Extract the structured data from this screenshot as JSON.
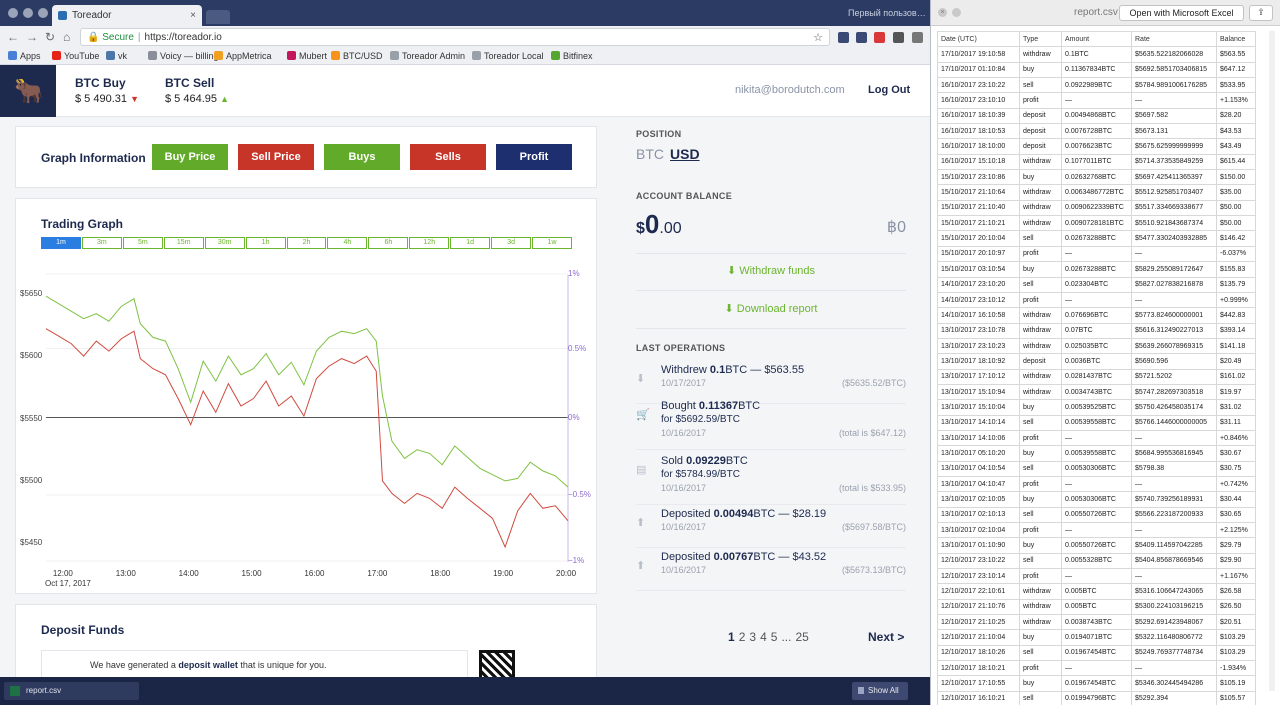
{
  "browser": {
    "tab_title": "Toreador",
    "user_label": "Первый пользов…",
    "secure_label": "Secure",
    "url": "https://toreador.io",
    "bookmarks": [
      {
        "label": "Apps",
        "color": "#4a7fd6"
      },
      {
        "label": "YouTube",
        "color": "#e62117"
      },
      {
        "label": "vk",
        "color": "#4a76a8"
      },
      {
        "label": "Voicy — billing",
        "color": "#8a8f99"
      },
      {
        "label": "AppMetrica",
        "color": "#f0a020"
      },
      {
        "label": "Mubert",
        "color": "#c2185b"
      },
      {
        "label": "BTC/USD",
        "color": "#f7931a"
      },
      {
        "label": "Toreador Admin",
        "color": "#9aa0a8"
      },
      {
        "label": "Toreador Local",
        "color": "#9aa0a8"
      },
      {
        "label": "Bitfinex",
        "color": "#55a630"
      }
    ]
  },
  "header": {
    "btc_buy_label": "BTC Buy",
    "btc_buy_value": "$ 5 490.31",
    "btc_sell_label": "BTC Sell",
    "btc_sell_value": "$ 5 464.95",
    "email": "nikita@borodutch.com",
    "logout": "Log Out"
  },
  "graph_info": {
    "title": "Graph Information",
    "buttons": [
      {
        "label": "Buy Price",
        "color": "#62ab2a"
      },
      {
        "label": "Sell Price",
        "color": "#c63528"
      },
      {
        "label": "Buys",
        "color": "#62ab2a"
      },
      {
        "label": "Sells",
        "color": "#c63528"
      },
      {
        "label": "Profit",
        "color": "#1d2f6f"
      }
    ]
  },
  "trading_graph": {
    "title": "Trading Graph",
    "timeframes": [
      "1m",
      "3m",
      "5m",
      "15m",
      "30m",
      "1h",
      "2h",
      "4h",
      "6h",
      "12h",
      "1d",
      "3d",
      "1w"
    ],
    "active_timeframe": "1m"
  },
  "chart_data": {
    "type": "line",
    "y_left_ticks": [
      "$5650",
      "$5600",
      "$5550",
      "$5500",
      "$5450"
    ],
    "y_right_ticks": [
      "1%",
      "0.5%",
      "0%",
      "−0.5%",
      "−1%"
    ],
    "x_ticks": [
      "12:00",
      "13:00",
      "14:00",
      "15:00",
      "16:00",
      "17:00",
      "18:00",
      "19:00",
      "20:00"
    ],
    "x_date_label": "Oct 17, 2017",
    "ylim": [
      5435,
      5665
    ],
    "xlim": [
      11.7,
      20.0
    ],
    "baseline": 5546,
    "series": [
      {
        "color": "#7ec244",
        "x": [
          11.7,
          11.9,
          12.1,
          12.3,
          12.5,
          12.7,
          12.9,
          13.1,
          13.2,
          13.4,
          13.6,
          13.8,
          14.0,
          14.2,
          14.4,
          14.6,
          14.8,
          15.0,
          15.2,
          15.4,
          15.6,
          15.8,
          16.0,
          16.2,
          16.4,
          16.6,
          16.8,
          16.95,
          17.05,
          17.2,
          17.4,
          17.6,
          17.8,
          18.0,
          18.2,
          18.4,
          18.6,
          18.8,
          19.0,
          19.2,
          19.4,
          19.6,
          19.8,
          20.0
        ],
        "values": [
          5648,
          5642,
          5636,
          5630,
          5634,
          5628,
          5640,
          5646,
          5626,
          5615,
          5612,
          5590,
          5563,
          5596,
          5580,
          5600,
          5585,
          5590,
          5602,
          5585,
          5595,
          5577,
          5604,
          5615,
          5620,
          5618,
          5622,
          5612,
          5568,
          5532,
          5518,
          5525,
          5522,
          5513,
          5528,
          5519,
          5510,
          5505,
          5500,
          5502,
          5515,
          5508,
          5504,
          5495
        ]
      },
      {
        "color": "#cf4a3e",
        "x": [
          11.7,
          11.9,
          12.1,
          12.3,
          12.5,
          12.7,
          12.9,
          13.1,
          13.2,
          13.4,
          13.6,
          13.8,
          14.0,
          14.2,
          14.4,
          14.6,
          14.8,
          15.0,
          15.2,
          15.4,
          15.6,
          15.8,
          16.0,
          16.2,
          16.4,
          16.6,
          16.8,
          16.95,
          17.05,
          17.2,
          17.4,
          17.6,
          17.8,
          18.0,
          18.2,
          18.4,
          18.6,
          18.8,
          19.0,
          19.2,
          19.4,
          19.6,
          19.8,
          20.0
        ],
        "values": [
          5622,
          5616,
          5610,
          5600,
          5612,
          5604,
          5614,
          5620,
          5598,
          5590,
          5585,
          5566,
          5545,
          5572,
          5555,
          5578,
          5560,
          5566,
          5580,
          5560,
          5568,
          5552,
          5582,
          5592,
          5598,
          5594,
          5600,
          5588,
          5500,
          5490,
          5482,
          5490,
          5486,
          5478,
          5495,
          5486,
          5478,
          5470,
          5447,
          5476,
          5490,
          5478,
          5480,
          5468
        ]
      }
    ]
  },
  "deposit": {
    "title": "Deposit Funds",
    "text_pre": "We have generated a ",
    "text_bold": "deposit wallet",
    "text_post": " that is unique for you."
  },
  "right": {
    "position_label": "POSITION",
    "pos_btc": "BTC",
    "pos_usd": "USD",
    "balance_label": "ACCOUNT BALANCE",
    "balance_sym": "$",
    "balance_int": "0",
    "balance_dec": ".00",
    "balance_btc": "฿0",
    "withdraw": "Withdraw funds",
    "download": "Download report",
    "last_ops_label": "LAST OPERATIONS"
  },
  "operations": [
    {
      "icon": "download-icon",
      "glyph": "⬇",
      "l1_pre": "Withdrew ",
      "l1_bold": "0.1",
      "l1_post": "BTC — $563.55",
      "l2": "",
      "date": "10/17/2017",
      "right": "($5635.52/BTC)"
    },
    {
      "icon": "cart-icon",
      "glyph": "🛒",
      "l1_pre": "Bought ",
      "l1_bold": "0.11367",
      "l1_post": "BTC",
      "l2": "for $5692.59/BTC",
      "date": "10/16/2017",
      "right": "(total is $647.12)"
    },
    {
      "icon": "store-icon",
      "glyph": "▤",
      "l1_pre": "Sold ",
      "l1_bold": "0.09229",
      "l1_post": "BTC",
      "l2": "for $5784.99/BTC",
      "date": "10/16/2017",
      "right": "(total is $533.95)"
    },
    {
      "icon": "upload-icon",
      "glyph": "⬆",
      "l1_pre": "Deposited ",
      "l1_bold": "0.00494",
      "l1_post": "BTC — $28.19",
      "l2": "",
      "date": "10/16/2017",
      "right": "($5697.58/BTC)"
    },
    {
      "icon": "upload-icon",
      "glyph": "⬆",
      "l1_pre": "Deposited ",
      "l1_bold": "0.00767",
      "l1_post": "BTC — $43.52",
      "l2": "",
      "date": "10/16/2017",
      "right": "($5673.13/BTC)"
    }
  ],
  "pagination": {
    "pages": [
      "1",
      "2",
      "3",
      "4",
      "5",
      "...",
      "25"
    ],
    "next": "Next >"
  },
  "downloads": {
    "file": "report.csv",
    "show_all": "Show All"
  },
  "csv": {
    "title": "report.csv",
    "open_excel": "Open with Microsoft Excel",
    "columns": [
      "Date (UTC)",
      "Type",
      "Amount",
      "Rate",
      "Balance"
    ],
    "rows": [
      [
        "17/10/2017 19:10:58",
        "withdraw",
        "0.1BTC",
        "$5635.522182066028",
        "$563.55"
      ],
      [
        "17/10/2017 01:10:84",
        "buy",
        "0.11367834BTC",
        "$5692.5851703406815",
        "$647.12"
      ],
      [
        "16/10/2017 23:10:22",
        "sell",
        "0.0922989BTC",
        "$5784.9891006176285",
        "$533.95"
      ],
      [
        "16/10/2017 23:10:10",
        "profit",
        "—",
        "—",
        "+1.153%"
      ],
      [
        "16/10/2017 18:10:39",
        "deposit",
        "0.00494868BTC",
        "$5697.582",
        "$28.20"
      ],
      [
        "16/10/2017 18:10:53",
        "deposit",
        "0.0076728BTC",
        "$5673.131",
        "$43.53"
      ],
      [
        "16/10/2017 18:10:00",
        "deposit",
        "0.0076623BTC",
        "$5675.625999999999",
        "$43.49"
      ],
      [
        "16/10/2017 15:10:18",
        "withdraw",
        "0.1077011BTC",
        "$5714.373535849259",
        "$615.44"
      ],
      [
        "15/10/2017 23:10:86",
        "buy",
        "0.02632768BTC",
        "$5697.425411365397",
        "$150.00"
      ],
      [
        "15/10/2017 21:10:64",
        "withdraw",
        "0.0063486772BTC",
        "$5512.925851703407",
        "$35.00"
      ],
      [
        "15/10/2017 21:10:40",
        "withdraw",
        "0.0090622339BTC",
        "$5517.334669338677",
        "$50.00"
      ],
      [
        "15/10/2017 21:10:21",
        "withdraw",
        "0.0090728181BTC",
        "$5510.921843687374",
        "$50.00"
      ],
      [
        "15/10/2017 20:10:04",
        "sell",
        "0.02673288BTC",
        "$5477.3302403932885",
        "$146.42"
      ],
      [
        "15/10/2017 20:10:97",
        "profit",
        "—",
        "—",
        "-6.037%"
      ],
      [
        "15/10/2017 03:10:54",
        "buy",
        "0.02673288BTC",
        "$5829.255089172647",
        "$155.83"
      ],
      [
        "14/10/2017 23:10:20",
        "sell",
        "0.023304BTC",
        "$5827.027838216878",
        "$135.79"
      ],
      [
        "14/10/2017 23:10:12",
        "profit",
        "—",
        "—",
        "+0.999%"
      ],
      [
        "14/10/2017 16:10:58",
        "withdraw",
        "0.076696BTC",
        "$5773.824600000001",
        "$442.83"
      ],
      [
        "13/10/2017 23:10:78",
        "withdraw",
        "0.07BTC",
        "$5616.312490227013",
        "$393.14"
      ],
      [
        "13/10/2017 23:10:23",
        "withdraw",
        "0.025035BTC",
        "$5639.266078969315",
        "$141.18"
      ],
      [
        "13/10/2017 18:10:92",
        "deposit",
        "0.0036BTC",
        "$5690.596",
        "$20.49"
      ],
      [
        "13/10/2017 17:10:12",
        "withdraw",
        "0.0281437BTC",
        "$5721.5202",
        "$161.02"
      ],
      [
        "13/10/2017 15:10:94",
        "withdraw",
        "0.0034743BTC",
        "$5747.282697303518",
        "$19.97"
      ],
      [
        "13/10/2017 15:10:04",
        "buy",
        "0.00539525BTC",
        "$5750.426458035174",
        "$31.02"
      ],
      [
        "13/10/2017 14:10:14",
        "sell",
        "0.00539558BTC",
        "$5766.1446000000005",
        "$31.11"
      ],
      [
        "13/10/2017 14:10:06",
        "profit",
        "—",
        "—",
        "+0.846%"
      ],
      [
        "13/10/2017 05:10:20",
        "buy",
        "0.00539558BTC",
        "$5684.995536816945",
        "$30.67"
      ],
      [
        "13/10/2017 04:10:54",
        "sell",
        "0.00530306BTC",
        "$5798.38",
        "$30.75"
      ],
      [
        "13/10/2017 04:10:47",
        "profit",
        "—",
        "—",
        "+0.742%"
      ],
      [
        "13/10/2017 02:10:05",
        "buy",
        "0.00530306BTC",
        "$5740.739256189931",
        "$30.44"
      ],
      [
        "13/10/2017 02:10:13",
        "sell",
        "0.00550726BTC",
        "$5566.223187200933",
        "$30.65"
      ],
      [
        "13/10/2017 02:10:04",
        "profit",
        "—",
        "—",
        "+2.125%"
      ],
      [
        "13/10/2017 01:10:90",
        "buy",
        "0.00550726BTC",
        "$5409.114597042285",
        "$29.79"
      ],
      [
        "12/10/2017 23:10:22",
        "sell",
        "0.0055328BTC",
        "$5404.856878669546",
        "$29.90"
      ],
      [
        "12/10/2017 23:10:14",
        "profit",
        "—",
        "—",
        "+1.167%"
      ],
      [
        "12/10/2017 22:10:61",
        "withdraw",
        "0.005BTC",
        "$5316.106647243065",
        "$26.58"
      ],
      [
        "12/10/2017 21:10:76",
        "withdraw",
        "0.005BTC",
        "$5300.224103196215",
        "$26.50"
      ],
      [
        "12/10/2017 21:10:25",
        "withdraw",
        "0.0038743BTC",
        "$5292.691423948067",
        "$20.51"
      ],
      [
        "12/10/2017 21:10:04",
        "buy",
        "0.0194071BTC",
        "$5322.116480806772",
        "$103.29"
      ],
      [
        "12/10/2017 18:10:26",
        "sell",
        "0.01967454BTC",
        "$5249.769377748734",
        "$103.29"
      ],
      [
        "12/10/2017 18:10:21",
        "profit",
        "—",
        "—",
        "-1.934%"
      ],
      [
        "12/10/2017 17:10:55",
        "buy",
        "0.01967454BTC",
        "$5346.302445494286",
        "$105.19"
      ],
      [
        "12/10/2017 16:10:21",
        "sell",
        "0.01994796BTC",
        "$5292.394",
        "$105.57"
      ]
    ]
  }
}
